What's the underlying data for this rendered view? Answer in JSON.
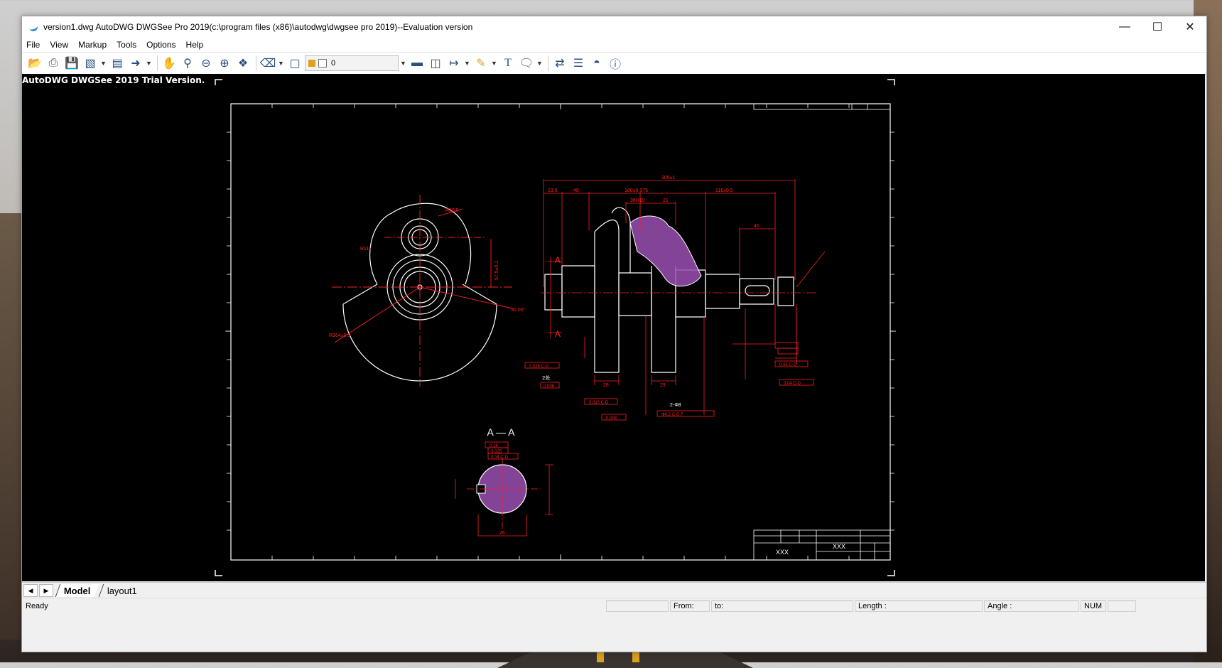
{
  "window": {
    "title": "version1.dwg AutoDWG DWGSee Pro 2019(c:\\program files (x86)\\autodwg\\dwgsee pro 2019)--Evaluation version",
    "minimize_icon": "minimize-icon",
    "maximize_icon": "maximize-icon",
    "close_icon": "close-icon"
  },
  "menu": [
    "File",
    "View",
    "Markup",
    "Tools",
    "Options",
    "Help"
  ],
  "toolbar": {
    "layer_value": "0",
    "icons": [
      "open-folder-icon",
      "print-icon",
      "save-icon",
      "batch-print-icon",
      "screen-icon",
      "arrow-icon",
      "pan-hand-icon",
      "zoom-window-icon",
      "zoom-out-icon",
      "zoom-in-icon",
      "zoom-extents-icon",
      "eraser-icon",
      "frame-icon",
      "layer-icon",
      "measure-icon",
      "distance-icon",
      "dimension-icon",
      "pen-icon",
      "text-icon",
      "comment-icon",
      "compare-icon",
      "hatch-icon",
      "binoculars-icon",
      "help-icon"
    ]
  },
  "canvas": {
    "trial_text": "AutoDWG DWGSee 2019 Trial Version.",
    "section_label": "A — A",
    "section_letter_a": "A",
    "title_block_xxx1": "XXX",
    "title_block_xxx2": "XXX",
    "dims": {
      "top_total": "305±1",
      "d1": "23.5",
      "d2": "40",
      "d3": "180±0.075",
      "d4": "116±0.5",
      "d5": "21",
      "d6": "36H10",
      "d7": "7",
      "d8": "40",
      "r1": "R38.5",
      "r2": "R117",
      "r3": "R964±0.5",
      "ang": "30.00°",
      "v1": "57.5±0.1",
      "b1": "28",
      "b2": "29",
      "tol1": "0.025 C-D",
      "tol2": "0.008",
      "tol3": "0.015 C-D",
      "tol4": "0.008",
      "tol5": "0.05 C-D",
      "tol6": "0.04 C-D",
      "tol7": "0.18",
      "tol8": "0.025",
      "tol9": "0.04 C-D",
      "holes": "2-Φ8",
      "holes_tol": "Φ0.2 C-D F",
      "sec_dim": "26",
      "a_label": "A",
      "note2": "2处"
    }
  },
  "tabs": {
    "nav_prev": "◀",
    "nav_next": "▶",
    "model": "Model",
    "layout": "layout1"
  },
  "status": {
    "ready": "Ready",
    "from": "From:",
    "to": "to:",
    "length": "Length :",
    "angle": "Angle :",
    "num": "NUM"
  },
  "colors": {
    "drawing_white": "#ffffff",
    "drawing_red": "#ff2020",
    "hatch_purple": "#9a4fb0"
  }
}
